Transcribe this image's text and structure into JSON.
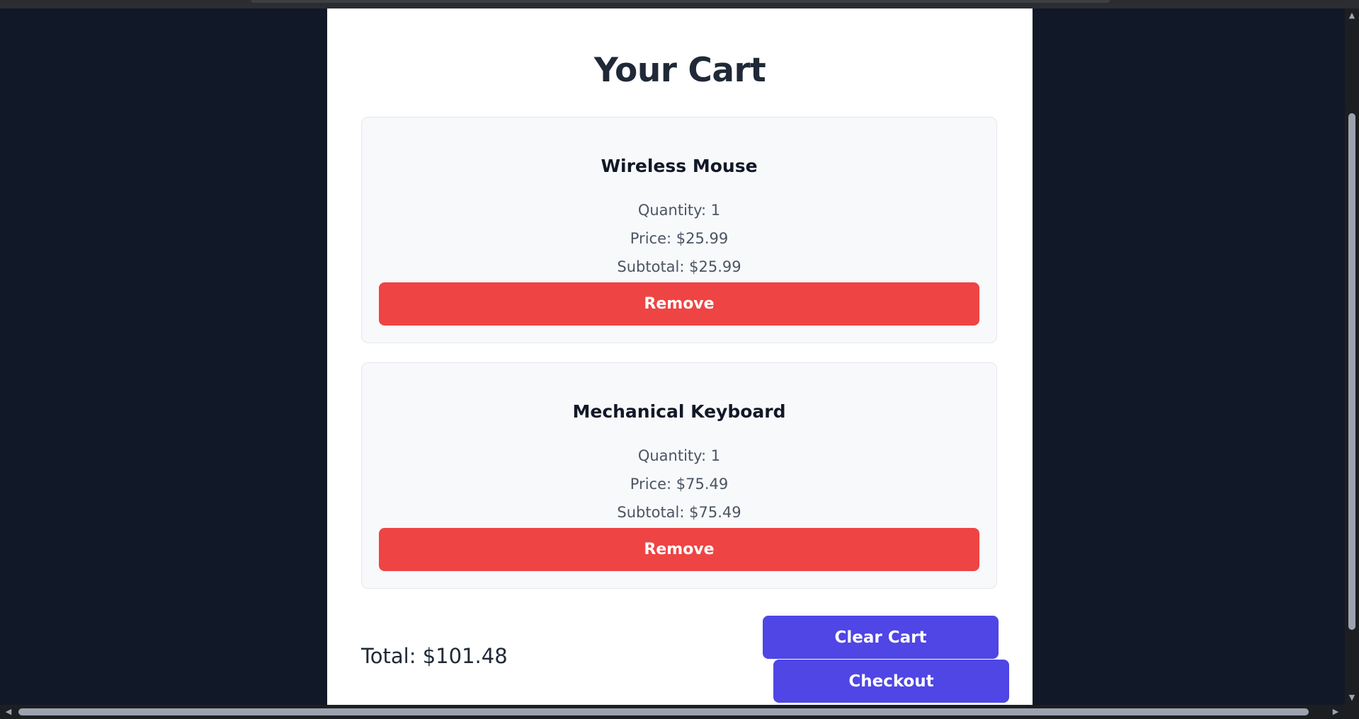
{
  "page": {
    "title": "Your Cart"
  },
  "cart": {
    "items": [
      {
        "name": "Wireless Mouse",
        "quantity": "Quantity: 1",
        "price": "Price: $25.99",
        "subtotal": "Subtotal: $25.99",
        "remove_label": "Remove"
      },
      {
        "name": "Mechanical Keyboard",
        "quantity": "Quantity: 1",
        "price": "Price: $75.49",
        "subtotal": "Subtotal: $75.49",
        "remove_label": "Remove"
      }
    ],
    "total": "Total: $101.48",
    "clear_label": "Clear Cart",
    "checkout_label": "Checkout"
  },
  "scrollbar": {
    "up_icon": "▲",
    "down_icon": "▼",
    "left_icon": "◀",
    "right_icon": "▶"
  },
  "colors": {
    "background": "#111827",
    "card": "#f8f9fb",
    "remove_button": "#ef4444",
    "primary_button": "#4f46e5",
    "heading": "#1f2937"
  }
}
